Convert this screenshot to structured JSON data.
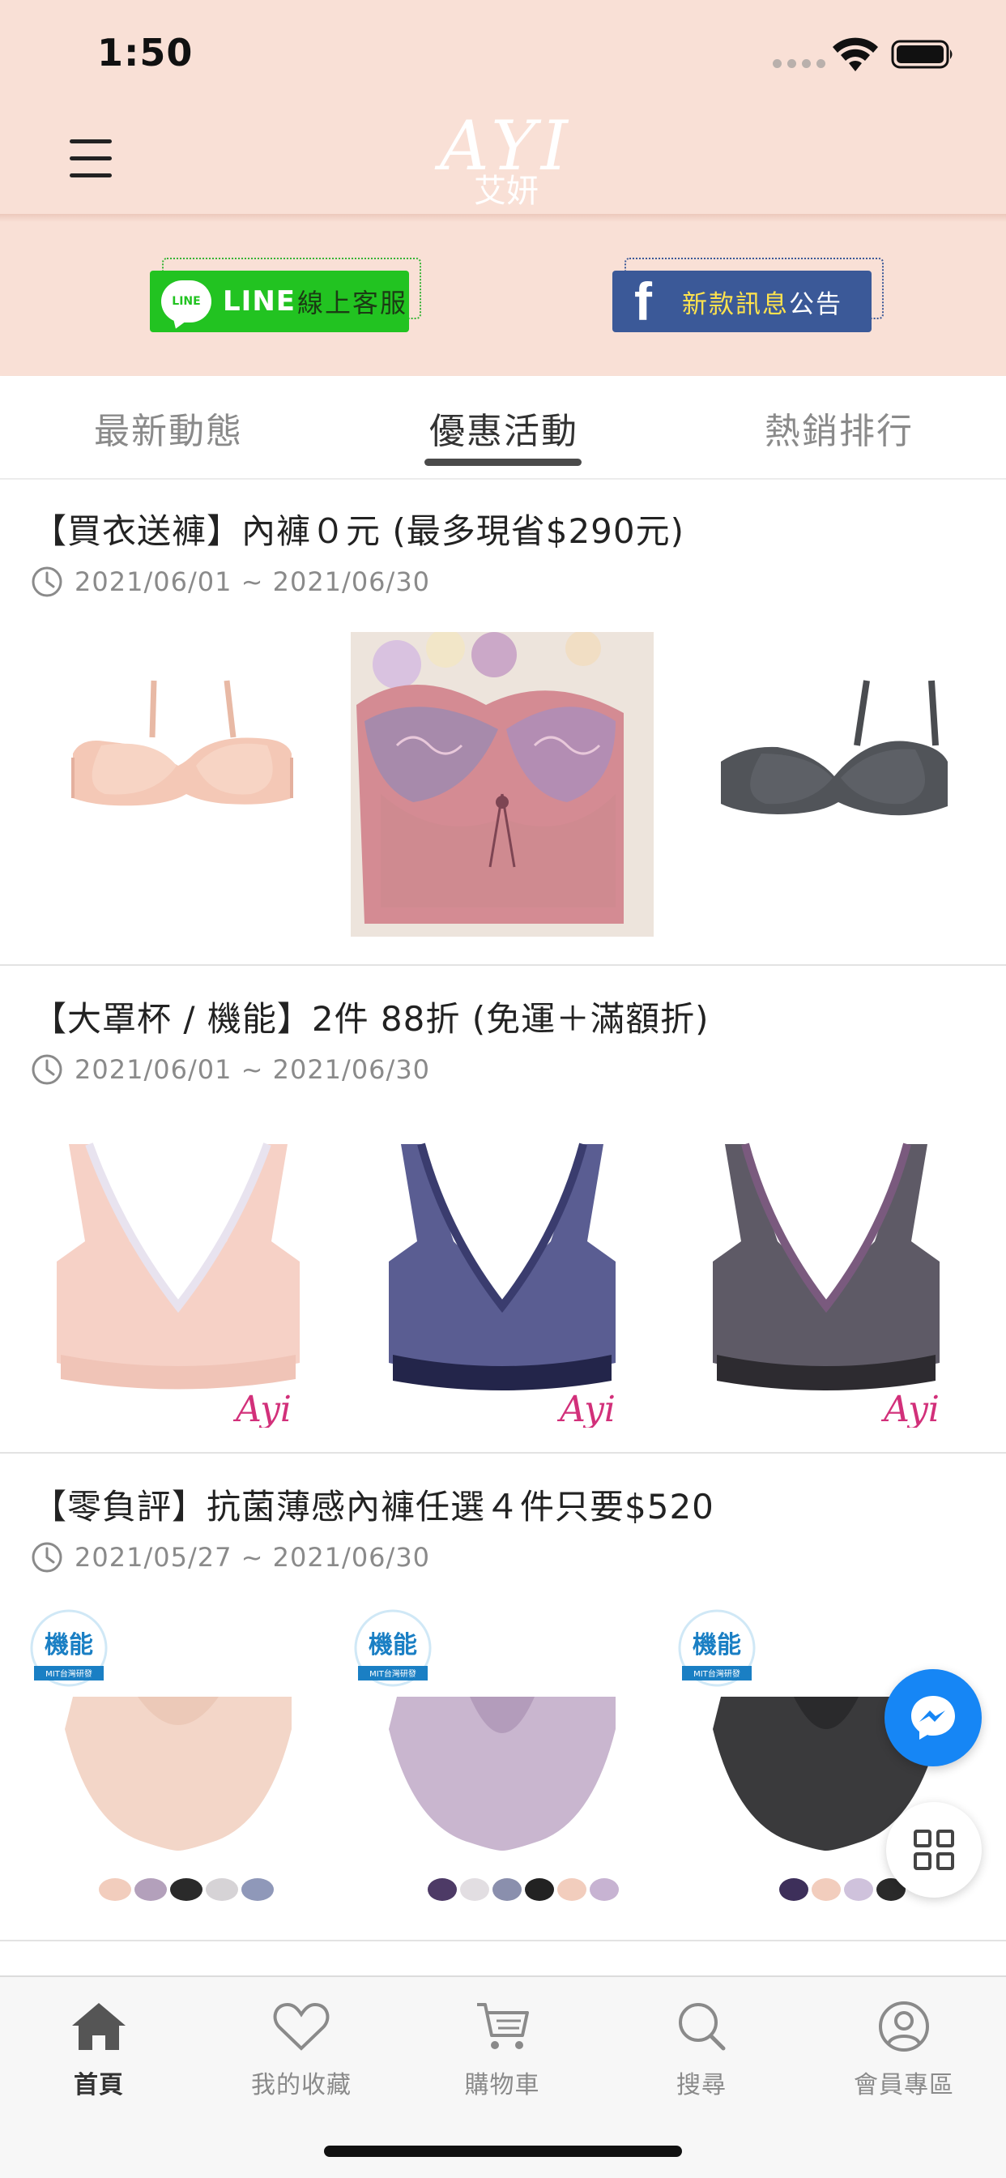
{
  "status_bar": {
    "time": "1:50"
  },
  "header": {
    "logo_text": "AYI",
    "logo_subtext": "艾妍",
    "line_button": {
      "brand": "LINE",
      "label": "線上客服",
      "logo_text": "LINE"
    },
    "fb_button": {
      "logo": "f",
      "label_highlight": "新款訊息",
      "label_rest": "公告"
    }
  },
  "tabs": [
    {
      "label": "最新動態",
      "active": false
    },
    {
      "label": "優惠活動",
      "active": true
    },
    {
      "label": "熱銷排行",
      "active": false
    }
  ],
  "promotions": [
    {
      "title": "【買衣送褲】內褲０元 (最多現省$290元)",
      "date": "2021/06/01 ~ 2021/06/30",
      "products": [
        "nude-tshirt-bra",
        "pink-lace-bra",
        "charcoal-tshirt-bra"
      ]
    },
    {
      "title": "【大罩杯 / 機能】2件 88折 (免運＋滿額折)",
      "date": "2021/06/01 ~ 2021/06/30",
      "products": [
        "nude-lace-full-bra",
        "navy-lace-full-bra",
        "gray-lace-full-bra"
      ],
      "watermark": "Ayi"
    },
    {
      "title": "【零負評】抗菌薄感內褲任選４件只要$520",
      "date": "2021/05/27 ~ 2021/06/30",
      "products": [
        "nude-panty",
        "lilac-panty",
        "black-panty"
      ],
      "badge_text": "機能",
      "badge_subtext": "MIT台灣研發"
    }
  ],
  "floating": {
    "messenger": "messenger-icon",
    "menu": "grid-icon"
  },
  "bottom_nav": [
    {
      "label": "首頁",
      "icon": "home-icon",
      "active": true
    },
    {
      "label": "我的收藏",
      "icon": "heart-icon",
      "active": false
    },
    {
      "label": "購物車",
      "icon": "cart-icon",
      "active": false
    },
    {
      "label": "搜尋",
      "icon": "search-icon",
      "active": false
    },
    {
      "label": "會員專區",
      "icon": "user-icon",
      "active": false
    }
  ],
  "colors": {
    "header_bg": "#f9e0d6",
    "line_green": "#22c321",
    "facebook_blue": "#3b5998",
    "messenger_blue": "#1686f5",
    "tab_indicator": "#4a4a4a"
  }
}
